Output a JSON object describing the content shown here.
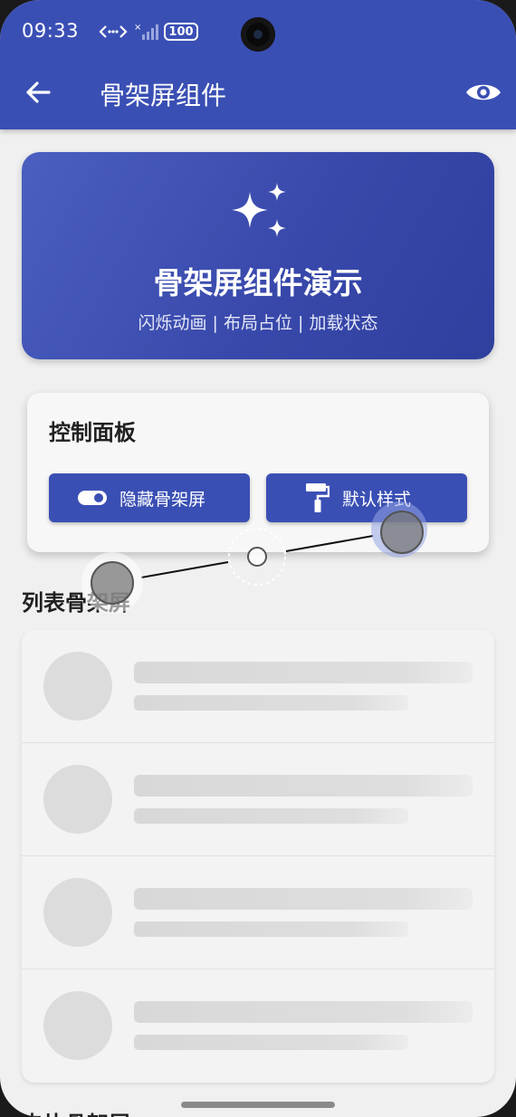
{
  "status_bar": {
    "time": "09:33",
    "battery": "100"
  },
  "app_bar": {
    "title": "骨架屏组件"
  },
  "hero": {
    "title": "骨架屏组件演示",
    "subtitle": "闪烁动画 | 布局占位 | 加载状态"
  },
  "control_panel": {
    "title": "控制面板",
    "hide_button": "隐藏骨架屏",
    "style_button": "默认样式"
  },
  "sections": {
    "list_title": "列表骨架屏",
    "next_title": "卡片骨架屏"
  },
  "skeleton_rows": 4,
  "colors": {
    "primary": "#3a4fb4",
    "background": "#f0f0f0",
    "skeleton": "#dcdcdc"
  }
}
